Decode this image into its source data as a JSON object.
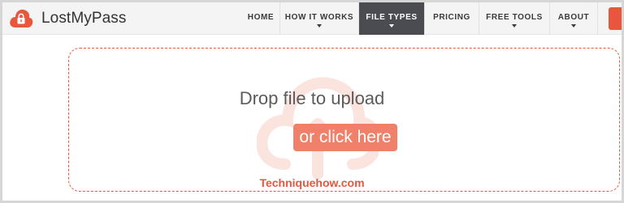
{
  "brand": {
    "name": "LostMyPass",
    "logo_icon": "cloud-lock-icon",
    "accent_color": "#e8563d"
  },
  "nav": {
    "items": [
      {
        "label": "HOME",
        "has_dropdown": false,
        "active": false
      },
      {
        "label": "HOW IT WORKS",
        "has_dropdown": true,
        "active": false
      },
      {
        "label": "FILE TYPES",
        "has_dropdown": true,
        "active": true
      },
      {
        "label": "PRICING",
        "has_dropdown": false,
        "active": false
      },
      {
        "label": "FREE TOOLS",
        "has_dropdown": true,
        "active": false
      },
      {
        "label": "ABOUT",
        "has_dropdown": true,
        "active": false
      }
    ],
    "active_bg_color": "#4a4c51"
  },
  "upload": {
    "prompt": "Drop file to upload",
    "button_label": "or click here",
    "background_icon": "cloud-upload-icon",
    "button_color": "#f0806a"
  },
  "watermark": {
    "text": "Techniquehow.com"
  }
}
